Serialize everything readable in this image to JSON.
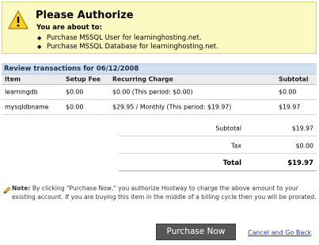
{
  "authorize": {
    "title": "Please Authorize",
    "subtitle": "You are about to:",
    "items": [
      "Purchase MSSQL User for learninghosting.net.",
      "Purchase MSSQL Database for learninghosting.net."
    ]
  },
  "review": {
    "heading": "Review transactions for 06/12/2008",
    "columns": [
      "Item",
      "Setup Fee",
      "Recurring Charge",
      "Subtotal"
    ],
    "rows": [
      {
        "item": "learningdb",
        "setup_fee": "$0.00",
        "recurring": "$0.00 (This period: $0.00)",
        "subtotal": "$0.00"
      },
      {
        "item": "mysqldbname",
        "setup_fee": "$0.00",
        "recurring": "$29.95 / Monthly (This period: $19.97)",
        "subtotal": "$19.97"
      }
    ],
    "summary": {
      "subtotal_label": "Subtotal",
      "subtotal_value": "$19.97",
      "tax_label": "Tax",
      "tax_value": "$0.00",
      "total_label": "Total",
      "total_value": "$19.97"
    }
  },
  "note": {
    "label": "Note:",
    "text": "By clicking \"Purchase Now,\" you authorize Hostway to charge the above amount to your existing account. If you are buying this item in the middle of a billing cycle then you will be prorated."
  },
  "actions": {
    "purchase_label": "Purchase Now",
    "cancel_label": "Cancel and Go Back"
  },
  "colors": {
    "banner_bg": "#fdf9c2",
    "header_bar": "#d3e0f0",
    "button_bg": "#575757",
    "link": "#1f2fa8"
  }
}
